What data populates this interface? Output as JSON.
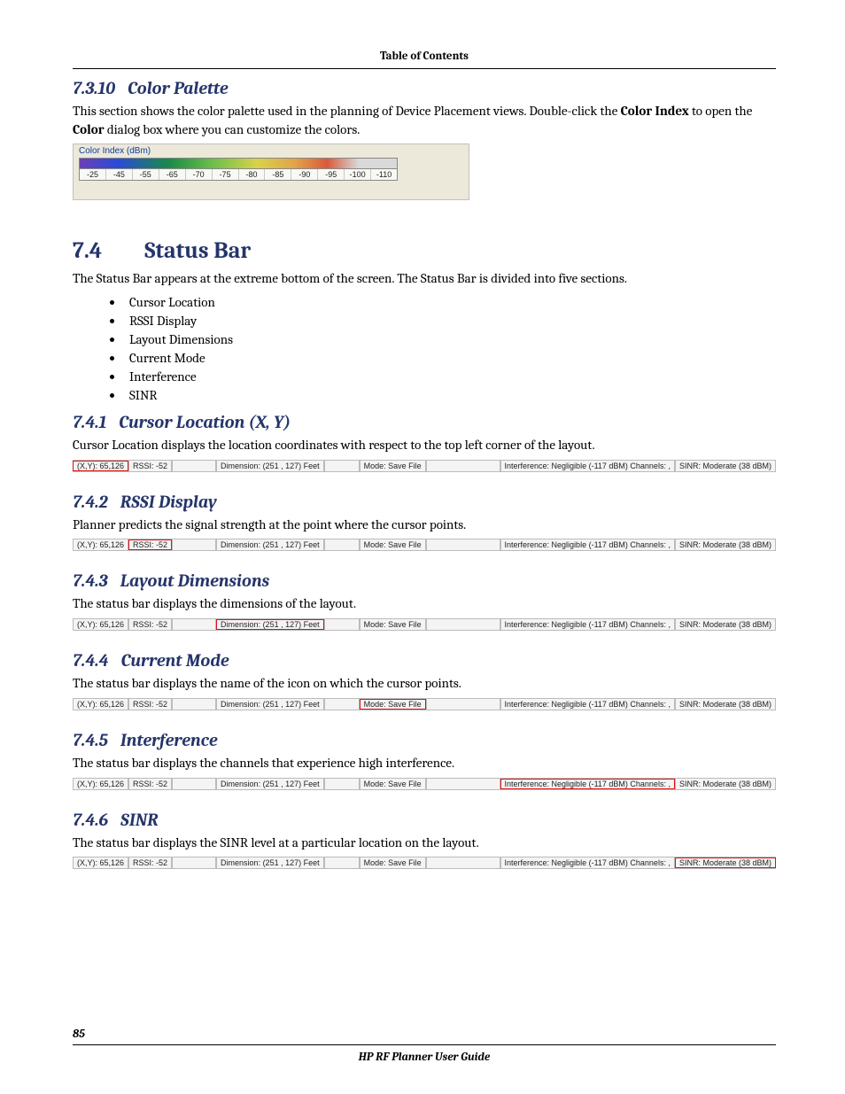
{
  "header": {
    "toc": "Table of Contents"
  },
  "s7310": {
    "num": "7.3.10",
    "title": "Color Palette",
    "p1a": "This section shows the color palette used in the planning of Device Placement views. Double-click the ",
    "p1b": "Color Index",
    "p1c": " to open the ",
    "p1d": "Color",
    "p1e": " dialog box where you can customize the colors.",
    "palette": {
      "caption": "Color Index (dBm)",
      "ticks": [
        "-25",
        "-45",
        "-55",
        "-65",
        "-70",
        "-75",
        "-80",
        "-85",
        "-90",
        "-95",
        "-100",
        "-110"
      ]
    }
  },
  "s74": {
    "num": "7.4",
    "title": "Status Bar",
    "intro": "The Status Bar appears at the extreme bottom of the screen. The Status Bar is divided into five sections.",
    "bullets": [
      "Cursor Location",
      "RSSI Display",
      "Layout Dimensions",
      "Current Mode",
      "Interference",
      "SINR"
    ]
  },
  "statusbar": {
    "xy": "(X,Y): 65,126",
    "rssi": "RSSI: -52",
    "dim": "Dimension: (251 , 127) Feet",
    "mode": "Mode: Save File",
    "intf": "Interference: Negligible (-117 dBM) Channels: ,",
    "sinr": "SINR: Moderate (38 dBM)"
  },
  "s741": {
    "num": "7.4.1",
    "title": "Cursor Location (X, Y)",
    "p": "Cursor Location displays the location coordinates with respect to the top left corner of the layout."
  },
  "s742": {
    "num": "7.4.2",
    "title": "RSSI Display",
    "p": "Planner predicts the signal strength at the point where the cursor points."
  },
  "s743": {
    "num": "7.4.3",
    "title": "Layout Dimensions",
    "p": "The status bar displays the dimensions of the layout."
  },
  "s744": {
    "num": "7.4.4",
    "title": "Current Mode",
    "p": "The status bar displays the name of the icon on which the cursor points."
  },
  "s745": {
    "num": "7.4.5",
    "title": "Interference",
    "p": "The status bar displays the channels that experience high interference."
  },
  "s746": {
    "num": "7.4.6",
    "title": "SINR",
    "p": "The status bar displays the SINR level at a particular location on the layout."
  },
  "footer": {
    "page": "85",
    "guide": "HP RF Planner User Guide"
  }
}
